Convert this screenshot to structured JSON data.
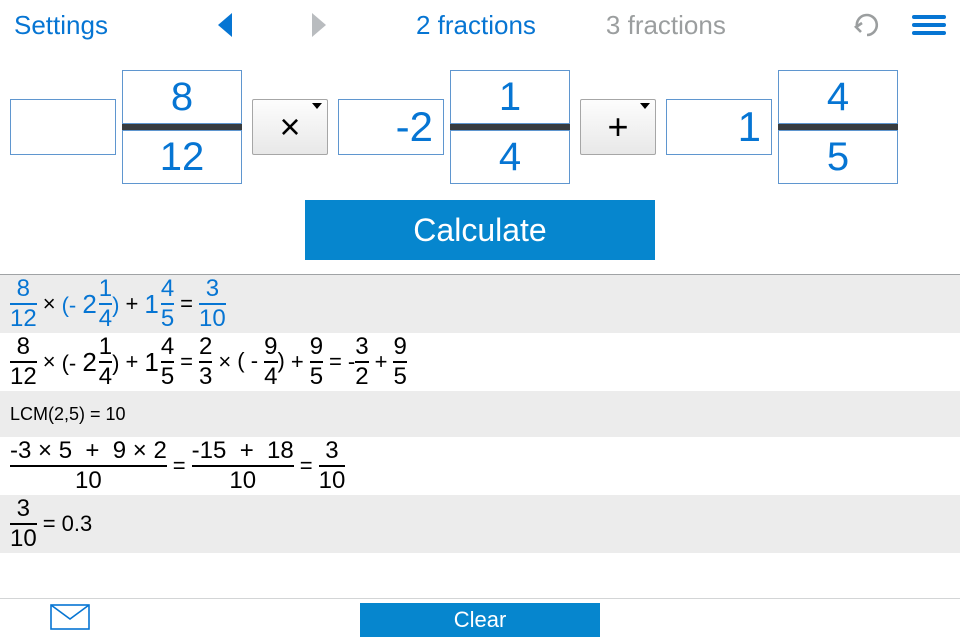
{
  "topbar": {
    "settings": "Settings",
    "tab2": "2 fractions",
    "tab3": "3 fractions"
  },
  "inputs": {
    "f1": {
      "whole": "",
      "num": "8",
      "den": "12"
    },
    "op1": "×",
    "f2": {
      "whole": "-2",
      "num": "1",
      "den": "4"
    },
    "op2": "+",
    "f3": {
      "whole": "1",
      "num": "4",
      "den": "5"
    }
  },
  "buttons": {
    "calculate": "Calculate",
    "clear": "Clear"
  },
  "result": {
    "l1": {
      "a_n": "8",
      "a_d": "12",
      "mul": "×",
      "lp": "(- ",
      "b_w": "2",
      "b_n": "1",
      "b_d": "4",
      "rp": ")",
      "plus": "+",
      "c_w": "1",
      "c_n": "4",
      "c_d": "5",
      "eq": "=",
      "r_n": "3",
      "r_d": "10"
    },
    "l2": {
      "a_n": "8",
      "a_d": "12",
      "mul": "×",
      "lp": "(- ",
      "b_w": "2",
      "b_n": "1",
      "b_d": "4",
      "rp": ")",
      "plus": "+",
      "c_w": "1",
      "c_n": "4",
      "c_d": "5",
      "eq": "=",
      "s1_n": "2",
      "s1_d": "3",
      "mul2": "×",
      "lp2": "( - ",
      "s2_n": "9",
      "s2_d": "4",
      "rp2": ")",
      "plus2": "+",
      "s3_n": "9",
      "s3_d": "5",
      "eq2": "=",
      "neg": "- ",
      "s4_n": "3",
      "s4_d": "2",
      "plus3": "+",
      "s5_n": "9",
      "s5_d": "5"
    },
    "l3": "LCM(2,5)  = 10",
    "l4": {
      "n1": "-3 × 5",
      "p": "+",
      "n2": "9 × 2",
      "d": "10",
      "eq": "=",
      "n3": "-15",
      "p2": "+",
      "n4": "18",
      "d2": "10",
      "eq2": "=",
      "rn": "3",
      "rd": "10"
    },
    "l5": {
      "n": "3",
      "d": "10",
      "eq": "= 0.3"
    }
  }
}
